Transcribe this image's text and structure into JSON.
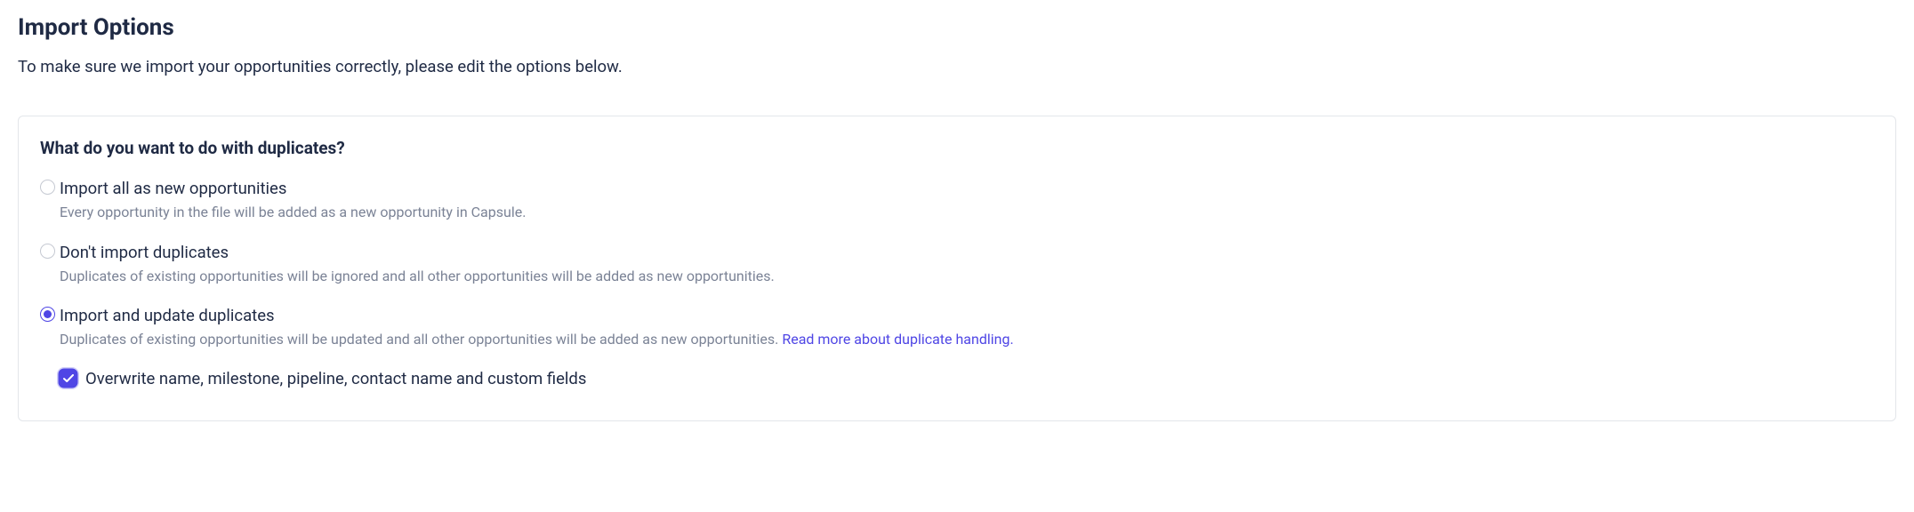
{
  "header": {
    "title": "Import Options",
    "subtitle": "To make sure we import your opportunities correctly, please edit the options below."
  },
  "panel": {
    "title": "What do you want to do with duplicates?",
    "options": [
      {
        "label": "Import all as new opportunities",
        "description": "Every opportunity in the file will be added as a new opportunity in Capsule."
      },
      {
        "label": "Don't import duplicates",
        "description": "Duplicates of existing opportunities will be ignored and all other opportunities will be added as new opportunities."
      },
      {
        "label": "Import and update duplicates",
        "description": "Duplicates of existing opportunities will be updated and all other opportunities will be added as new opportunities. ",
        "link_text": "Read more about duplicate handling."
      }
    ],
    "sub_option": {
      "label": "Overwrite name, milestone, pipeline, contact name and custom fields"
    }
  }
}
